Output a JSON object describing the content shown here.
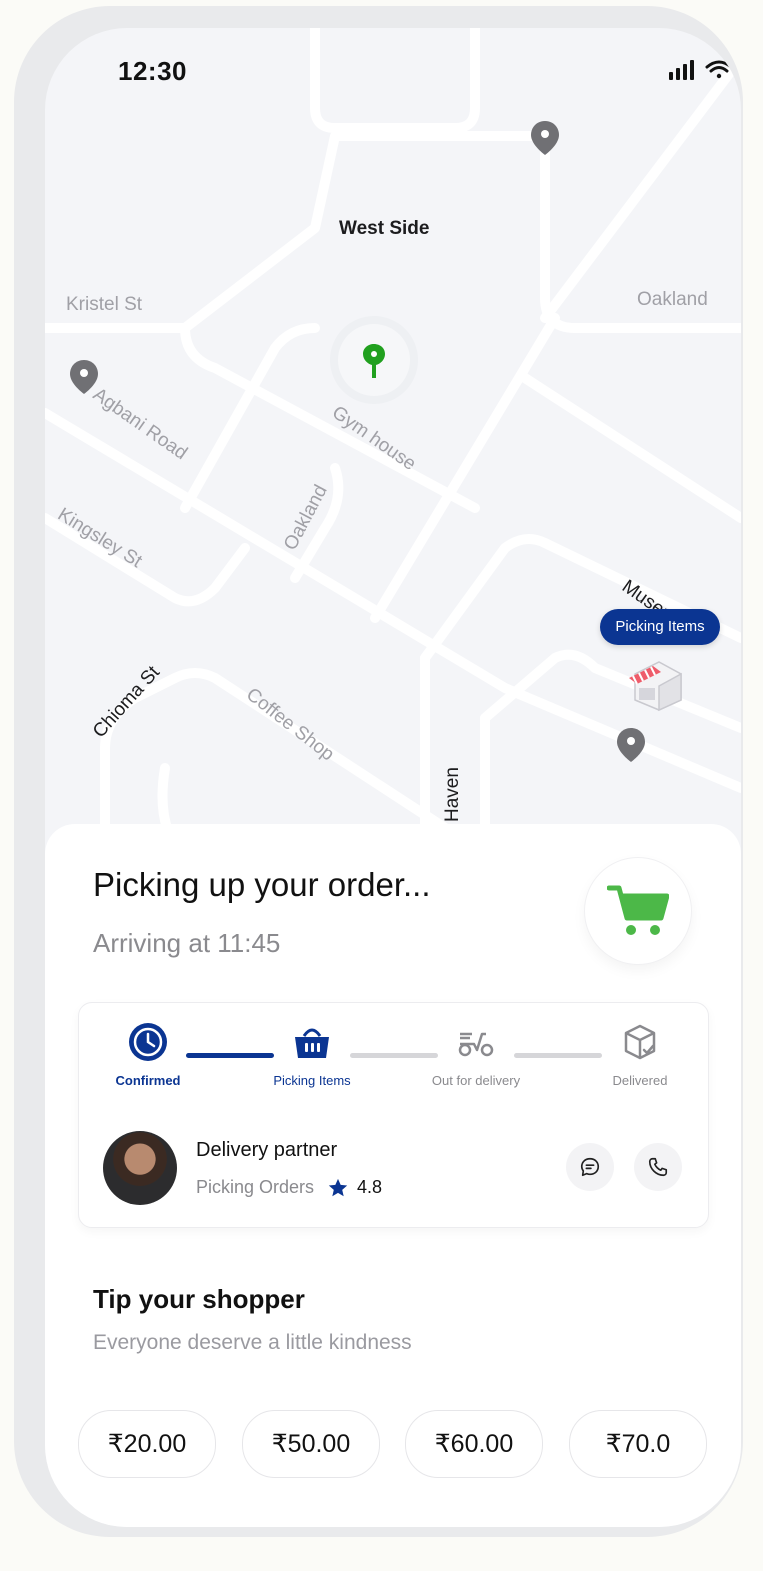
{
  "status_bar": {
    "time": "12:30"
  },
  "map": {
    "labels": {
      "west_side": "West Side",
      "kristel": "Kristel St",
      "oakland_right": "Oakland",
      "agbani": "Agbani Road",
      "gym": "Gym house",
      "kingsley": "Kingsley St",
      "oakland_mid": "Oakland",
      "museum": "Museum",
      "chioma": "Chioma St",
      "coffee": "Coffee Shop",
      "haven": "Haven"
    },
    "store_tag": "Picking Items"
  },
  "order": {
    "title": "Picking up your order...",
    "subtitle": "Arriving at 11:45"
  },
  "progress": {
    "steps": [
      {
        "label": "Confirmed",
        "icon": "clock-icon",
        "state": "done"
      },
      {
        "label": "Picking Items",
        "icon": "basket-icon",
        "state": "active"
      },
      {
        "label": "Out for delivery",
        "icon": "scooter-icon",
        "state": "pending"
      },
      {
        "label": "Delivered",
        "icon": "package-icon",
        "state": "pending"
      }
    ]
  },
  "partner": {
    "name": "Delivery partner",
    "status": "Picking Orders",
    "rating": "4.8"
  },
  "tip": {
    "title": "Tip your shopper",
    "subtitle": "Everyone deserve a little kindness",
    "options": [
      "₹20.00",
      "₹50.00",
      "₹60.00",
      "₹70.0"
    ]
  },
  "colors": {
    "accent": "#0b3592",
    "green": "#21a01f",
    "cart": "#4cb848"
  }
}
